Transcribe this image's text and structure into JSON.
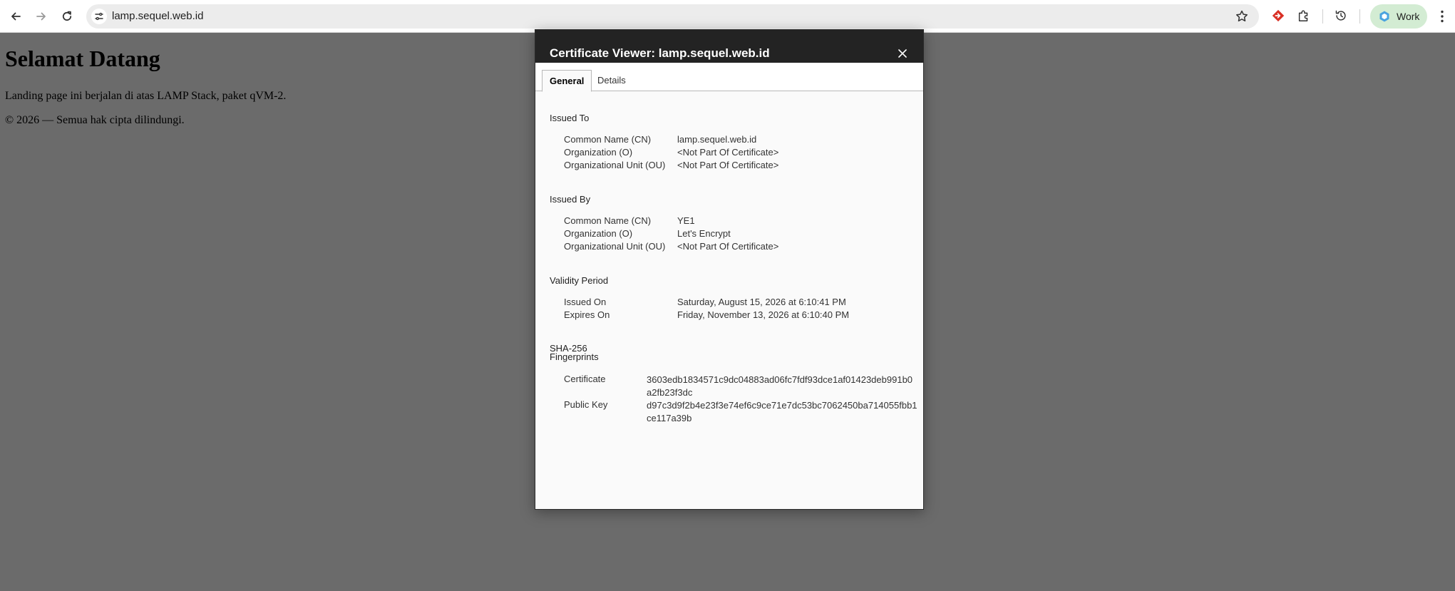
{
  "browser": {
    "url": "lamp.sequel.web.id",
    "profile_label": "Work",
    "icons": [
      "back-arrow-icon",
      "forward-arrow-icon",
      "reload-icon",
      "site-settings-icon",
      "bookmark-star-icon",
      "extension-diamond-icon",
      "puzzle-extensions-icon",
      "history-icon",
      "profile-icon",
      "menu-kebab-icon"
    ]
  },
  "page": {
    "heading": "Selamat Datang",
    "paragraph": "Landing page ini berjalan di atas LAMP Stack, paket qVM-2.",
    "footer": "© 2026 — Semua hak cipta dilindungi."
  },
  "dialog": {
    "title": "Certificate Viewer: lamp.sequel.web.id",
    "tabs": [
      {
        "label": "General",
        "active": true
      },
      {
        "label": "Details",
        "active": false
      }
    ],
    "issued_to": {
      "title": "Issued To",
      "rows": [
        {
          "label": "Common Name (CN)",
          "value": "lamp.sequel.web.id"
        },
        {
          "label": "Organization (O)",
          "value": "<Not Part Of Certificate>"
        },
        {
          "label": "Organizational Unit (OU)",
          "value": "<Not Part Of Certificate>"
        }
      ]
    },
    "issued_by": {
      "title": "Issued By",
      "rows": [
        {
          "label": "Common Name (CN)",
          "value": "YE1"
        },
        {
          "label": "Organization (O)",
          "value": "Let's Encrypt"
        },
        {
          "label": "Organizational Unit (OU)",
          "value": "<Not Part Of Certificate>"
        }
      ]
    },
    "validity": {
      "title": "Validity Period",
      "rows": [
        {
          "label": "Issued On",
          "value": "Saturday, August 15, 2026 at 6:10:41 PM"
        },
        {
          "label": "Expires On",
          "value": "Friday, November 13, 2026 at 6:10:40 PM"
        }
      ]
    },
    "fingerprints": {
      "title_line1": "SHA-256",
      "title_line2": "Fingerprints",
      "rows": [
        {
          "label": "Certificate",
          "value": "3603edb1834571c9dc04883ad06fc7fdf93dce1af01423deb991b0a2fb23f3dc"
        },
        {
          "label": "Public Key",
          "value": "d97c3d9f2b4e23f3e74ef6c9ce71e7dc53bc7062450ba714055fbb1ce117a39b"
        }
      ]
    }
  }
}
